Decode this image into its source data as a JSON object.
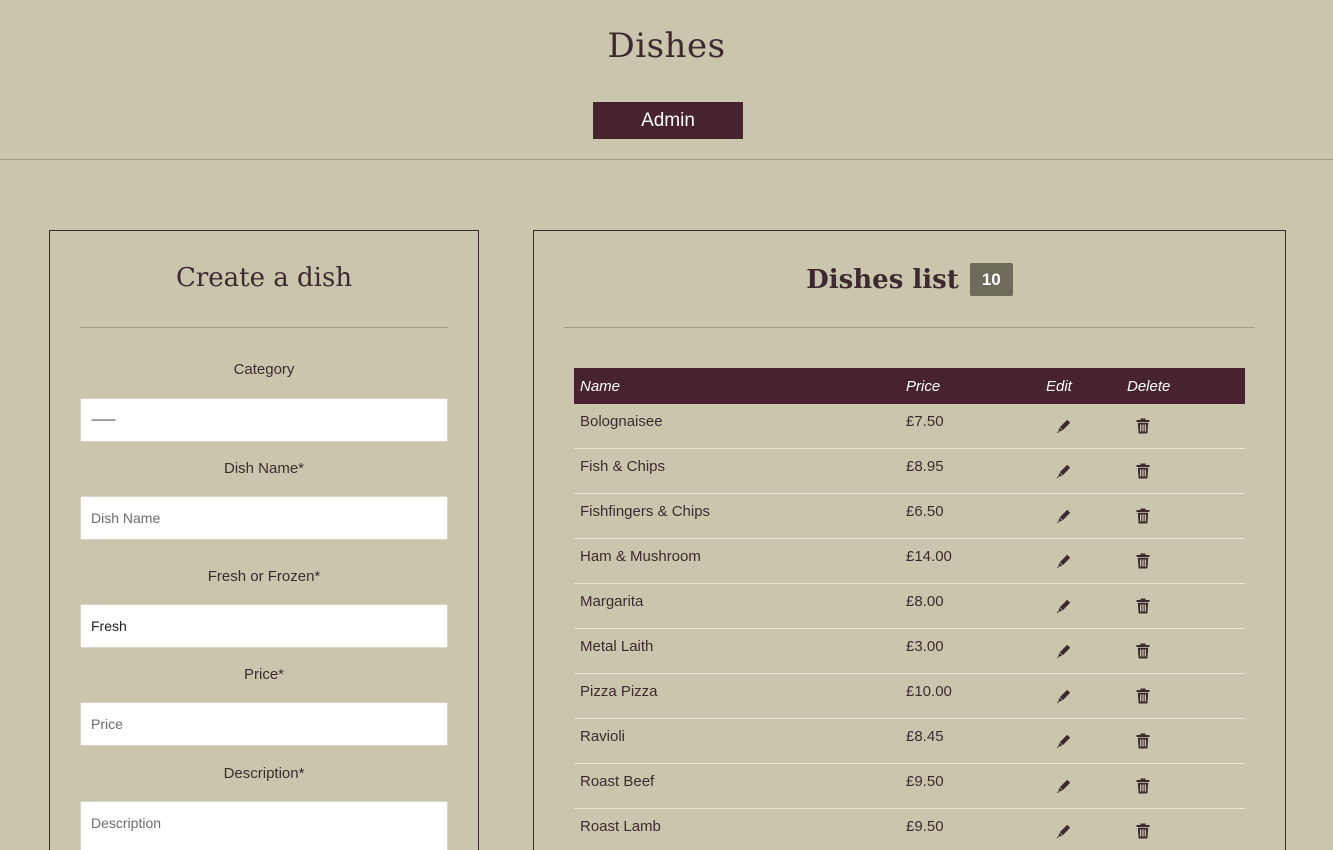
{
  "header": {
    "title": "Dishes",
    "admin_button": "Admin"
  },
  "create_form": {
    "title": "Create a dish",
    "category_label": "Category",
    "category_value": "---------",
    "dish_name_label": "Dish Name*",
    "dish_name_placeholder": "Dish Name",
    "fresh_frozen_label": "Fresh or Frozen*",
    "fresh_frozen_value": "Fresh",
    "price_label": "Price*",
    "price_placeholder": "Price",
    "description_label": "Description*",
    "description_placeholder": "Description"
  },
  "dishes_list": {
    "title": "Dishes list",
    "count": "10",
    "columns": {
      "name": "Name",
      "price": "Price",
      "edit": "Edit",
      "delete": "Delete"
    },
    "rows": [
      {
        "name": "Bolognaisee",
        "price": "£7.50"
      },
      {
        "name": "Fish & Chips",
        "price": "£8.95"
      },
      {
        "name": "Fishfingers & Chips",
        "price": "£6.50"
      },
      {
        "name": "Ham & Mushroom",
        "price": "£14.00"
      },
      {
        "name": "Margarita",
        "price": "£8.00"
      },
      {
        "name": "Metal Laith",
        "price": "£3.00"
      },
      {
        "name": "Pizza Pizza",
        "price": "£10.00"
      },
      {
        "name": "Ravioli",
        "price": "£8.45"
      },
      {
        "name": "Roast Beef",
        "price": "£9.50"
      },
      {
        "name": "Roast Lamb",
        "price": "£9.50"
      }
    ]
  },
  "colors": {
    "background": "#cac6ae",
    "accent": "#472330",
    "badge": "#6e6a5c",
    "text": "#3d2a30"
  },
  "icons": {
    "edit": "pen-icon",
    "delete": "trash-icon"
  }
}
